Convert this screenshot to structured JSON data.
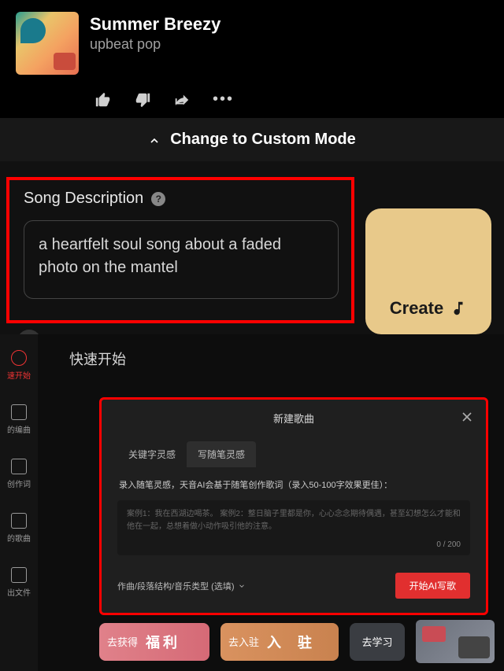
{
  "song": {
    "title": "Summer Breezy",
    "genre": "upbeat pop"
  },
  "mode": {
    "label": "Change to Custom Mode"
  },
  "description": {
    "label": "Song Description",
    "value": "a heartfelt soul song about a faded photo on the mantel",
    "help": "?"
  },
  "create": {
    "label": "Create"
  },
  "bottom": {
    "quick_start": "快速开始",
    "sidebar": [
      {
        "label": "速开始"
      },
      {
        "label": "的编曲"
      },
      {
        "label": "创作词"
      },
      {
        "label": "的歌曲"
      },
      {
        "label": "出文件"
      }
    ],
    "modal": {
      "title": "新建歌曲",
      "tabs": [
        "关键字灵感",
        "写随笔灵感"
      ],
      "active_tab": 1,
      "desc": "录入随笔灵感，天音AI会基于随笔创作歌词（录入50-100字效果更佳）：",
      "examples": "案例1：我在西湖边喝茶。\n案例2：整日脑子里都是你，心心念念期待偶遇，甚至幻想怎么才能和他在一起，总想着做小动作吸引他的注意。",
      "counter": "0 / 200",
      "footer_left": "作曲/段落结构/音乐类型 (选填)",
      "start_btn": "开始AI写歌"
    },
    "cards": {
      "pink_small": "去获得",
      "pink_big": "福利",
      "orange_small": "去入驻",
      "orange_big": "入 驻",
      "gray": "去学习"
    }
  }
}
